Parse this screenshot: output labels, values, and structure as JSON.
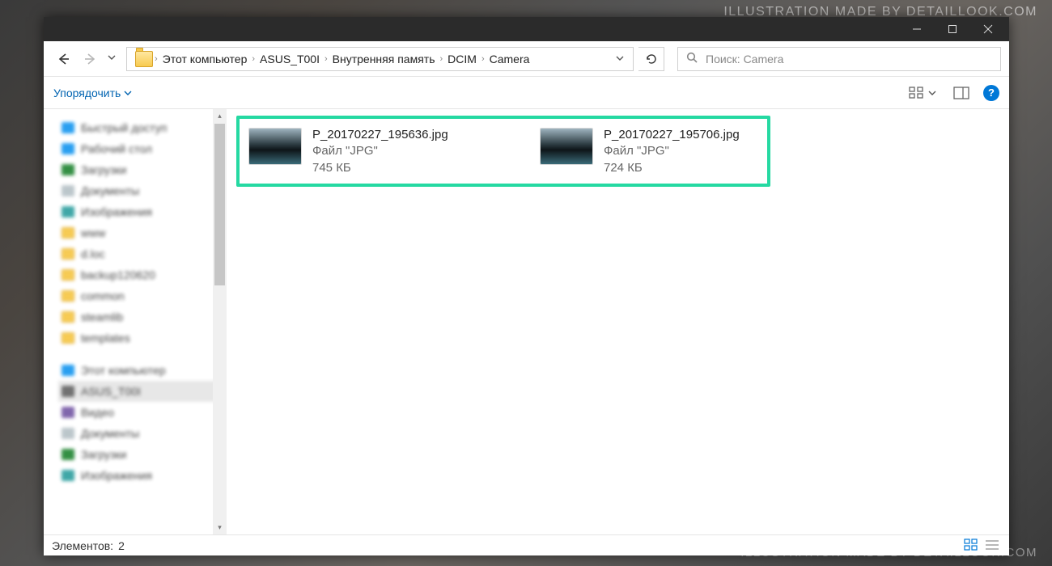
{
  "watermark": "ILLUSTRATION MADE BY DETAILLOOK.COM",
  "titlebar": {
    "name": ""
  },
  "breadcrumb": {
    "items": [
      "Этот компьютер",
      "ASUS_T00I",
      "Внутренняя память",
      "DCIM",
      "Camera"
    ]
  },
  "search": {
    "placeholder": "Поиск: Camera"
  },
  "toolbar": {
    "organize": "Упорядочить"
  },
  "sidebar": {
    "items": [
      {
        "label": "Быстрый доступ"
      },
      {
        "label": "Рабочий стол"
      },
      {
        "label": "Загрузки"
      },
      {
        "label": "Документы"
      },
      {
        "label": "Изображения"
      },
      {
        "label": "www"
      },
      {
        "label": "d.loc"
      },
      {
        "label": "backup120620"
      },
      {
        "label": "common"
      },
      {
        "label": "steamlib"
      },
      {
        "label": "templates"
      }
    ],
    "group2": [
      {
        "label": "Этот компьютер"
      },
      {
        "label": "ASUS_T00I"
      },
      {
        "label": "Видео"
      },
      {
        "label": "Документы"
      },
      {
        "label": "Загрузки"
      },
      {
        "label": "Изображения"
      }
    ]
  },
  "files": [
    {
      "name": "P_20170227_195636.jpg",
      "type": "Файл \"JPG\"",
      "size": "745 КБ"
    },
    {
      "name": "P_20170227_195706.jpg",
      "type": "Файл \"JPG\"",
      "size": "724 КБ"
    }
  ],
  "status": {
    "label": "Элементов:",
    "count": "2"
  },
  "help": "?"
}
